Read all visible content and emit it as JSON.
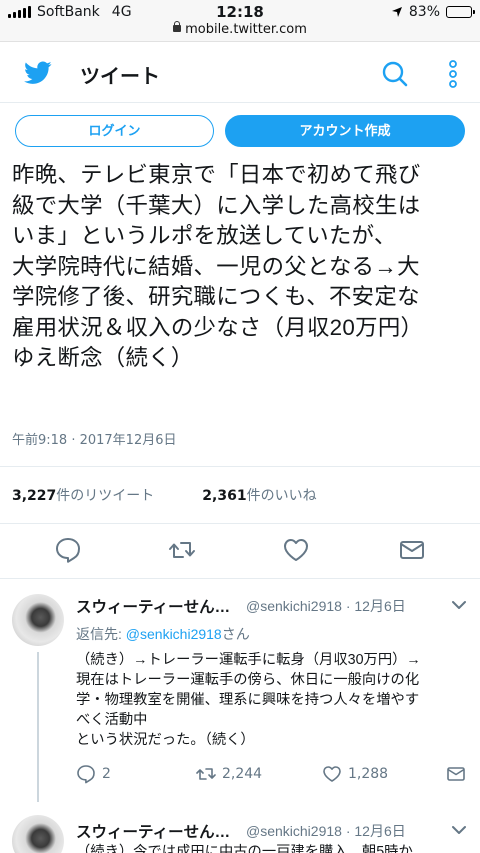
{
  "status_bar": {
    "carrier": "SoftBank",
    "network": "4G",
    "time": "12:18",
    "battery": "83%",
    "battery_level": 0.83
  },
  "browser": {
    "url": "mobile.twitter.com"
  },
  "header": {
    "title": "ツイート",
    "icons": [
      "twitter-bird-icon",
      "search-icon",
      "more-vertical-icon"
    ]
  },
  "auth": {
    "login_label": "ログイン",
    "signup_label": "アカウント作成"
  },
  "tweet": {
    "lines": [
      "昨晩、テレビ東京で「日本で初めて飛び",
      "級で大学（千葉大）に入学した高校生は",
      "いま」というルポを放送していたが、",
      "大学院時代に結婚、一児の父となる→大",
      "学院修了後、研究職につくも、不安定な",
      "雇用状況＆収入の少なさ（月収20万円）",
      "ゆえ断念（続く）"
    ],
    "timestamp": "午前9:18 · 2017年12月6日",
    "retweets_count": "3,227",
    "retweets_label": "件のリツイート",
    "likes_count": "2,361",
    "likes_label": "件のいいね",
    "action_icons": [
      "reply-icon",
      "retweet-icon",
      "like-icon",
      "message-icon"
    ]
  },
  "replies": [
    {
      "name": "スウィーティーせん…",
      "handle_date": "@senkichi2918 · 12月6日",
      "reply_to_prefix": "返信先: ",
      "reply_to_mention": "@senkichi2918",
      "reply_to_suffix": "さん",
      "lines": [
        "（続き）→トレーラー運転手に転身（月収30万円）→",
        "現在はトレーラー運転手の傍ら、休日に一般向けの化",
        "学・物理教室を開催、理系に興味を持つ人々を増やす",
        "べく活動中",
        "という状況だった。（続く）"
      ],
      "reply_count": "2",
      "retweet_count": "2,244",
      "like_count": "1,288"
    },
    {
      "name": "スウィーティーせん…",
      "handle_date": "@senkichi2918 · 12月6日",
      "partial_line": "（続き）今では成田に中古の一戸建を購入、朝5時か"
    }
  ],
  "colors": {
    "accent": "#1da1f2",
    "text": "#14171a",
    "muted": "#657786",
    "border": "#e6ecf0"
  }
}
